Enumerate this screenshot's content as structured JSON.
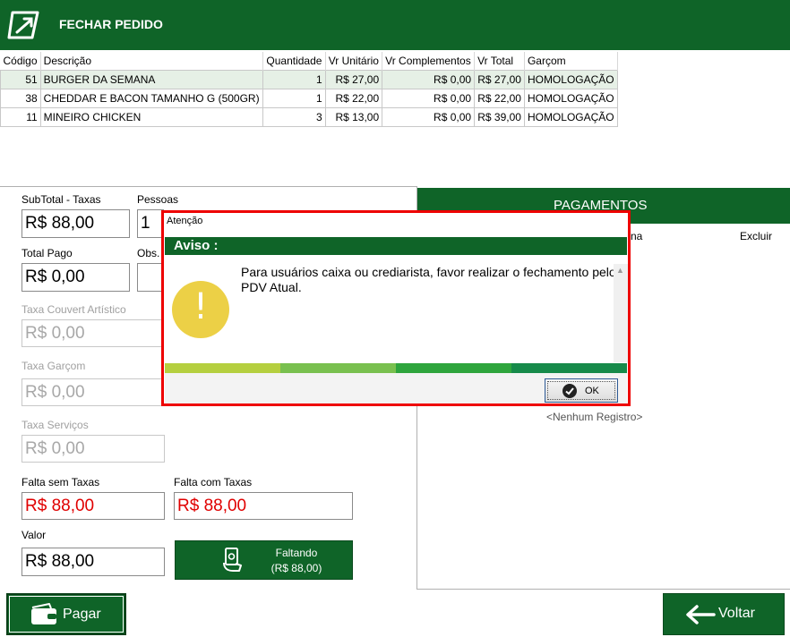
{
  "header": {
    "title": "FECHAR PEDIDO"
  },
  "items_table": {
    "columns": [
      "Código",
      "Descrição",
      "Quantidade",
      "Vr Unitário",
      "Vr Complementos",
      "Vr Total",
      "Garçom"
    ],
    "rows": [
      [
        "51",
        "BURGER DA SEMANA",
        "1",
        "R$ 27,00",
        "R$ 0,00",
        "R$ 27,00",
        "HOMOLOGAÇÃO"
      ],
      [
        "38",
        "CHEDDAR E BACON TAMANHO G (500GR)",
        "1",
        "R$ 22,00",
        "R$ 0,00",
        "R$ 22,00",
        "HOMOLOGAÇÃO"
      ],
      [
        "11",
        "MINEIRO CHICKEN",
        "3",
        "R$ 13,00",
        "R$ 0,00",
        "R$ 39,00",
        "HOMOLOGAÇÃO"
      ]
    ]
  },
  "form": {
    "subtotal_label": "SubTotal - Taxas",
    "subtotal_value": "R$ 88,00",
    "pessoas_label": "Pessoas",
    "pessoas_value": "1",
    "total_pago_label": "Total Pago",
    "total_pago_value": "R$ 0,00",
    "obs_label": "Obs.",
    "couvert_label": "Taxa Couvert Artístico",
    "couvert_value": "R$ 0,00",
    "garcom_label": "Taxa Garçom",
    "garcom_value": "R$ 0,00",
    "servicos_label": "Taxa Serviços",
    "servicos_value": "R$ 0,00",
    "falta_sem_label": "Falta sem Taxas",
    "falta_sem_value": "R$ 88,00",
    "falta_com_label": "Falta com Taxas",
    "falta_com_value": "R$ 88,00",
    "valor_label": "Valor",
    "valor_value": "R$ 88,00",
    "faltando_label": "Faltando",
    "faltando_value": "(R$ 88,00)"
  },
  "payments": {
    "title": "PAGAMENTOS",
    "col_partial": "na",
    "col_excluir": "Excluir",
    "empty_text": "<Nenhum Registro>"
  },
  "buttons": {
    "pagar": "Pagar",
    "voltar": "Voltar"
  },
  "dialog": {
    "window_title": "Atenção",
    "header": "Aviso :",
    "message": "Para usuários caixa ou crediarista, favor realizar o fechamento pelo PDV Atual.",
    "ok_label": "OK",
    "strip_colors": [
      "#b5cf3f",
      "#79c04f",
      "#2ea53d",
      "#168a4a"
    ]
  },
  "colors": {
    "brand_green": "#0f6428",
    "alert_red": "#e00000",
    "warning_yellow": "#ecd046"
  }
}
